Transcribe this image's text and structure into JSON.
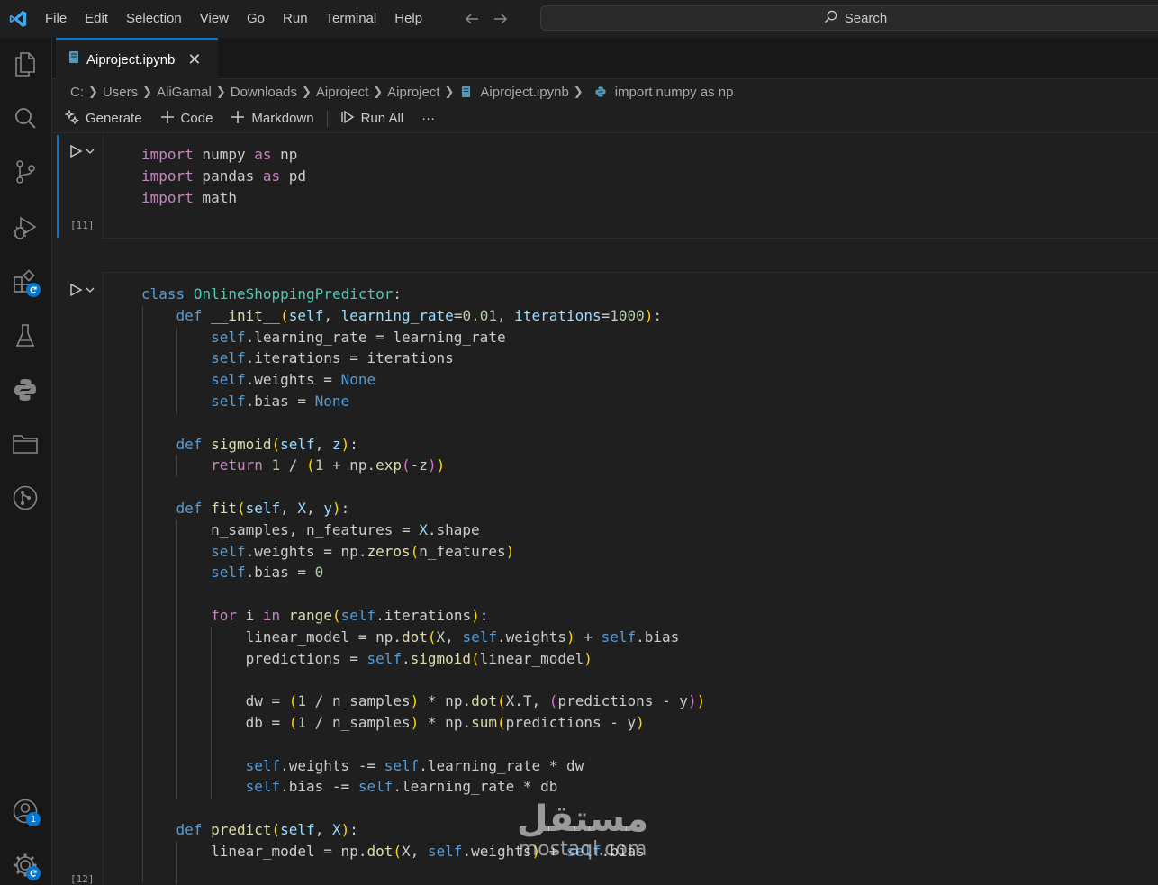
{
  "menu": [
    "File",
    "Edit",
    "Selection",
    "View",
    "Go",
    "Run",
    "Terminal",
    "Help"
  ],
  "search": {
    "label": "Search"
  },
  "activity_bar": {
    "icons": [
      "explorer-icon",
      "search-icon",
      "source-control-icon",
      "run-debug-icon",
      "extensions-icon",
      "testing-icon",
      "python-icon",
      "folder-icon",
      "git-graph-icon",
      "accounts-icon",
      "manage-icon"
    ],
    "accounts_badge": "1"
  },
  "tab": {
    "label": "Aiproject.ipynb",
    "close": "✕"
  },
  "breadcrumb": [
    "C:",
    "Users",
    "AliGamal",
    "Downloads",
    "Aiproject",
    "Aiproject",
    "Aiproject.ipynb",
    "import numpy as np"
  ],
  "toolbar": {
    "generate": "Generate",
    "code": "Code",
    "markdown": "Markdown",
    "run_all": "Run All",
    "more": "···"
  },
  "cells": [
    {
      "execution_count": "[11]",
      "source": [
        "import numpy as np",
        "import pandas as pd",
        "import math"
      ]
    },
    {
      "execution_count": "[12]",
      "source": [
        "class OnlineShoppingPredictor:",
        "    def __init__(self, learning_rate=0.01, iterations=1000):",
        "        self.learning_rate = learning_rate",
        "        self.iterations = iterations",
        "        self.weights = None",
        "        self.bias = None",
        "",
        "    def sigmoid(self, z):",
        "        return 1 / (1 + np.exp(-z))",
        "",
        "    def fit(self, X, y):",
        "        n_samples, n_features = X.shape",
        "        self.weights = np.zeros(n_features)",
        "        self.bias = 0",
        "",
        "        for i in range(self.iterations):",
        "            linear_model = np.dot(X, self.weights) + self.bias",
        "            predictions = self.sigmoid(linear_model)",
        "",
        "            dw = (1 / n_samples) * np.dot(X.T, (predictions - y))",
        "            db = (1 / n_samples) * np.sum(predictions - y)",
        "",
        "            self.weights -= self.learning_rate * dw",
        "            self.bias -= self.learning_rate * db",
        "",
        "    def predict(self, X):",
        "        linear_model = np.dot(X, self.weights) + self.bias"
      ]
    }
  ],
  "watermark": {
    "arabic": "مستقل",
    "latin": "mostaql.com"
  }
}
